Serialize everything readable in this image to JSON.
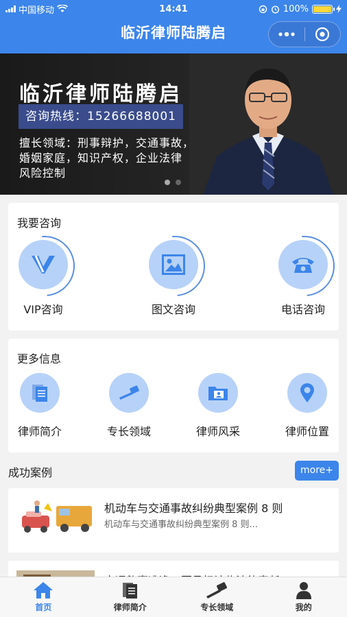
{
  "status": {
    "carrier": "中国移动",
    "time": "14:41",
    "battery_text": "100%",
    "battery_level": 1.0
  },
  "nav": {
    "title": "临沂律师陆腾启",
    "more_icon": "ellipsis-icon",
    "close_icon": "target-icon"
  },
  "banner": {
    "title": "临沂律师陆腾启",
    "hotline": "咨询热线：15266688001",
    "desc_lines": [
      "擅长领域：刑事辩护，交通事故，",
      "婚姻家庭，知识产权，企业法律",
      "风险控制"
    ],
    "active_dot": 1,
    "dot_count": 2
  },
  "consult": {
    "title": "我要咨询",
    "items": [
      {
        "label": "VIP咨询",
        "icon": "vip-icon"
      },
      {
        "label": "图文咨询",
        "icon": "image-icon"
      },
      {
        "label": "电话咨询",
        "icon": "phone-icon"
      }
    ]
  },
  "more_info": {
    "title": "更多信息",
    "items": [
      {
        "label": "律师简介",
        "icon": "document-icon"
      },
      {
        "label": "专长领域",
        "icon": "gavel-icon"
      },
      {
        "label": "律师风采",
        "icon": "folder-photo-icon"
      },
      {
        "label": "律师位置",
        "icon": "location-icon"
      }
    ]
  },
  "cases": {
    "title": "成功案例",
    "more_label": "more+",
    "items": [
      {
        "title": "机动车与交通事故纠纷典型案例 8 则",
        "summary": "机动车与交通事故纠纷典型案例 8 则..."
      },
      {
        "title": "交通肇事逃逸，要承担该些法律责任",
        "summary": ""
      }
    ]
  },
  "tabbar": {
    "items": [
      {
        "label": "首页",
        "icon": "home-icon",
        "active": true
      },
      {
        "label": "律师简介",
        "icon": "document-icon",
        "active": false
      },
      {
        "label": "专长领域",
        "icon": "gavel-icon",
        "active": false
      },
      {
        "label": "我的",
        "icon": "user-icon",
        "active": false
      }
    ]
  },
  "colors": {
    "primary": "#3c85ea",
    "icon_bg": "#b7d2f8",
    "icon_fg": "#3c85ea"
  }
}
